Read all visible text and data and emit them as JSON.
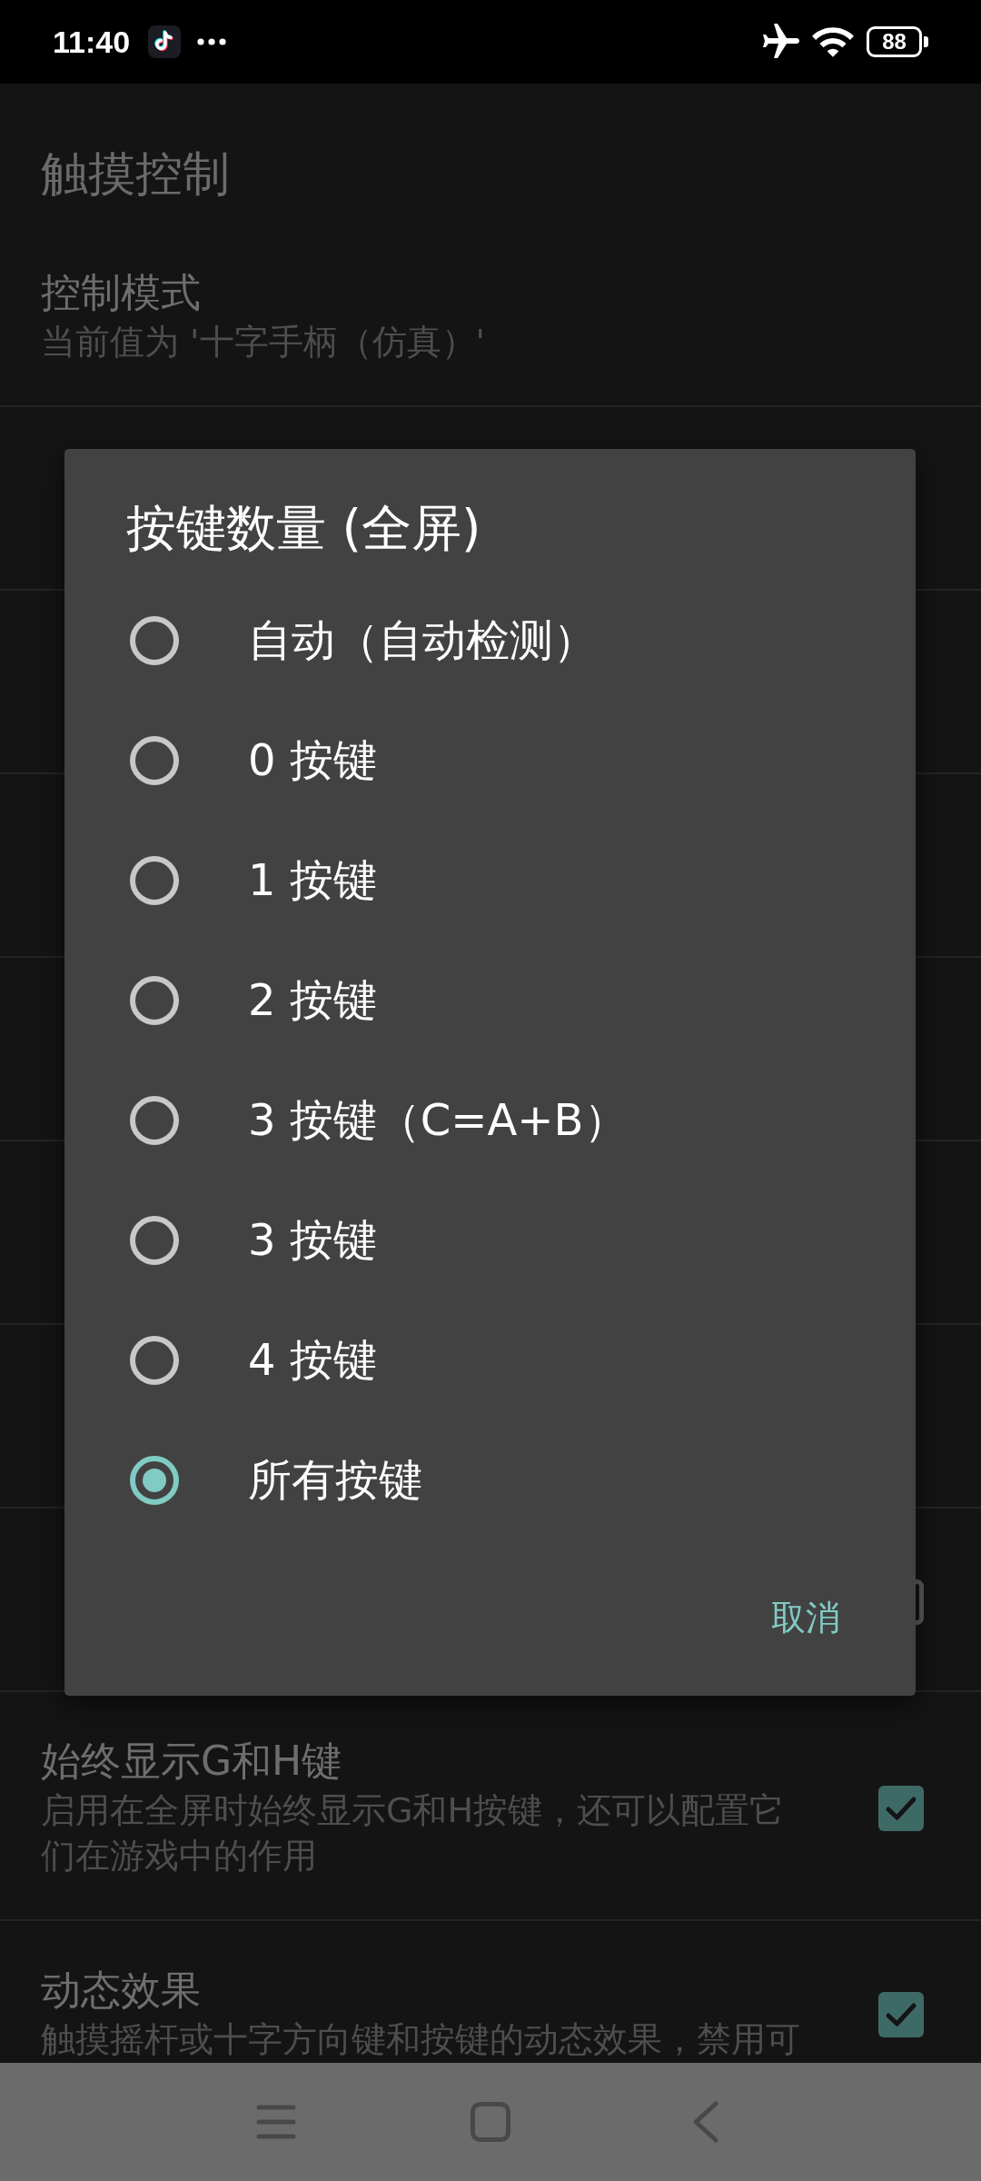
{
  "status_bar": {
    "time": "11:40",
    "battery": "88"
  },
  "page": {
    "title": "触摸控制"
  },
  "settings": [
    {
      "title": "控制模式",
      "summary": "当前值为 '十字手柄（仿真）'",
      "kind": "list"
    },
    {
      "kind": "list"
    },
    {
      "kind": "list"
    },
    {
      "kind": "list"
    },
    {
      "kind": "list"
    },
    {
      "kind": "list"
    },
    {
      "kind": "list"
    },
    {
      "kind": "checkbox",
      "checked": false
    },
    {
      "title": "始终显示G和H键",
      "summary": "启用在全屏时始终显示G和H按键，还可以配置它们在游戏中的作用",
      "kind": "checkbox",
      "checked": true
    },
    {
      "title": "动态效果",
      "summary": "触摸摇杆或十字方向键和按键的动态效果，禁用可",
      "kind": "checkbox",
      "checked": true
    }
  ],
  "dialog": {
    "title": "按键数量 (全屏)",
    "options": [
      {
        "label": "自动（自动检测）",
        "selected": false
      },
      {
        "label": "0 按键",
        "selected": false
      },
      {
        "label": "1 按键",
        "selected": false
      },
      {
        "label": "2 按键",
        "selected": false
      },
      {
        "label": "3 按键（C=A+B）",
        "selected": false
      },
      {
        "label": "3 按键",
        "selected": false
      },
      {
        "label": "4 按键",
        "selected": false
      },
      {
        "label": "所有按键",
        "selected": true
      }
    ],
    "buttons": [
      "取消"
    ]
  }
}
